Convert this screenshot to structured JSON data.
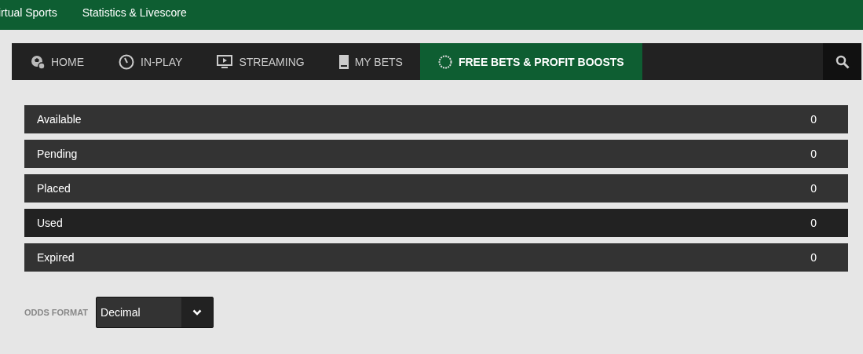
{
  "top_links": [
    "irtual Sports",
    "Statistics & Livescore"
  ],
  "tabs": [
    {
      "label": "HOME",
      "kind": "home",
      "selected": false
    },
    {
      "label": "IN-PLAY",
      "kind": "inplay",
      "selected": false
    },
    {
      "label": "STREAMING",
      "kind": "streaming",
      "selected": false
    },
    {
      "label": "MY BETS",
      "kind": "mybets",
      "selected": false
    },
    {
      "label": "FREE BETS & PROFIT BOOSTS",
      "kind": "freebets",
      "selected": true
    }
  ],
  "rows": [
    {
      "label": "Available",
      "count": "0",
      "selected": false
    },
    {
      "label": "Pending",
      "count": "0",
      "selected": false
    },
    {
      "label": "Placed",
      "count": "0",
      "selected": false
    },
    {
      "label": "Used",
      "count": "0",
      "selected": true
    },
    {
      "label": "Expired",
      "count": "0",
      "selected": false
    }
  ],
  "odds_format": {
    "label": "ODDS FORMAT",
    "value": "Decimal"
  }
}
